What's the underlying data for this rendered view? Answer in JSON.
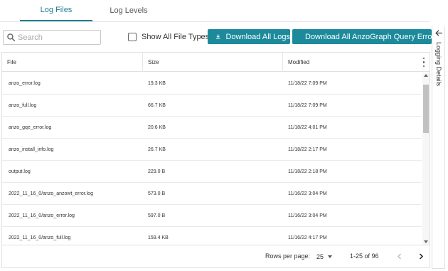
{
  "tabs": [
    {
      "label": "Log Files",
      "active": true
    },
    {
      "label": "Log Levels",
      "active": false
    }
  ],
  "toolbar": {
    "search_placeholder": "Search",
    "show_all_label": "Show All File Types",
    "show_all_checked": false,
    "download_logs_label": "Download All Logs",
    "download_anzograph_label": "Download All AnzoGraph Query Errors"
  },
  "table": {
    "columns": [
      "File",
      "Size",
      "Modified"
    ],
    "rows": [
      {
        "file": "anzo_error.log",
        "size": "19.3 KB",
        "modified": "11/18/22 7:09 PM"
      },
      {
        "file": "anzo_full.log",
        "size": "66.7 KB",
        "modified": "11/18/22 7:09 PM"
      },
      {
        "file": "anzo_gqe_error.log",
        "size": "20.6 KB",
        "modified": "11/18/22 4:01 PM"
      },
      {
        "file": "anzo_install_info.log",
        "size": "26.7 KB",
        "modified": "11/18/22 2:17 PM"
      },
      {
        "file": "output.log",
        "size": "229.0 B",
        "modified": "11/18/22 2:18 PM"
      },
      {
        "file": "2022_11_16_0/anzo_anzowt_error.log",
        "size": "573.0 B",
        "modified": "11/16/22 3:04 PM"
      },
      {
        "file": "2022_11_16_0/anzo_error.log",
        "size": "597.0 B",
        "modified": "11/16/22 3:04 PM"
      },
      {
        "file": "2022_11_16_0/anzo_full.log",
        "size": "159.4 KB",
        "modified": "11/16/22 4:17 PM"
      }
    ]
  },
  "pagination": {
    "rows_per_page_label": "Rows per page:",
    "rows_per_page": "25",
    "range": "1-25 of 96"
  },
  "side_panel": {
    "label": "Logging Details"
  },
  "colors": {
    "accent": "#1d8a9c",
    "active_tab": "#1d7f94"
  },
  "icons": {
    "search": "search-icon",
    "download": "download-icon",
    "kebab": "more-vert-icon",
    "prev": "chevron-left-icon",
    "next": "chevron-right-icon",
    "back": "arrow-left-icon"
  }
}
